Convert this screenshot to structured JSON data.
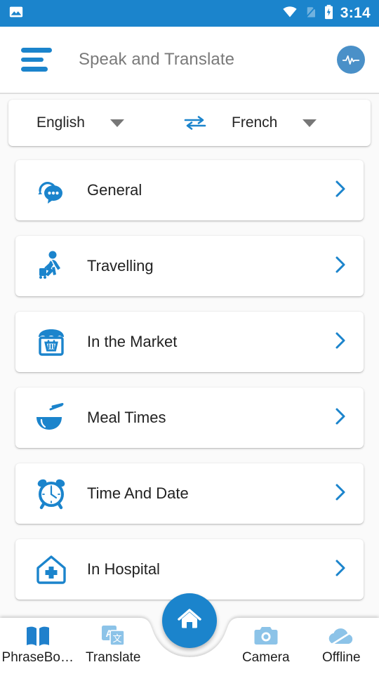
{
  "status_bar": {
    "time": "3:14",
    "icons": [
      "image-icon",
      "wifi-icon",
      "sim-card-off-icon",
      "battery-charging-icon"
    ],
    "background_color": "#1b84cc"
  },
  "app_bar": {
    "menu_icon": "hamburger-menu-icon",
    "title": "Speak and Translate",
    "action_icon": "voice-pulse-icon",
    "title_color": "#7a7a7a",
    "accent_color": "#1b84cc"
  },
  "language_selector": {
    "source_language": "English",
    "target_language": "French",
    "swap_icon": "swap-horizontal-icon",
    "caret_icon": "chevron-down-icon"
  },
  "categories": [
    {
      "label": "General",
      "icon": "chat-bubbles-icon",
      "chevron": "chevron-right-icon"
    },
    {
      "label": "Travelling",
      "icon": "traveller-icon",
      "chevron": "chevron-right-icon"
    },
    {
      "label": "In the Market",
      "icon": "store-basket-icon",
      "chevron": "chevron-right-icon"
    },
    {
      "label": "Meal Times",
      "icon": "bowl-chopsticks-icon",
      "chevron": "chevron-right-icon"
    },
    {
      "label": "Time And Date",
      "icon": "alarm-clock-icon",
      "chevron": "chevron-right-icon"
    },
    {
      "label": "In Hospital",
      "icon": "hospital-house-icon",
      "chevron": "chevron-right-icon"
    }
  ],
  "bottom_nav": {
    "items": [
      {
        "label": "PhraseBo…",
        "icon": "open-book-icon",
        "color": "#1f80cc"
      },
      {
        "label": "Translate",
        "icon": "translate-icon",
        "color": "#8cc3e8"
      },
      {
        "label": "Camera",
        "icon": "camera-icon",
        "color": "#8cc3e8"
      },
      {
        "label": "Offline",
        "icon": "cloud-offline-icon",
        "color": "#8cc3e8"
      }
    ],
    "fab": {
      "icon": "home-icon",
      "color": "#1b84cc"
    }
  }
}
